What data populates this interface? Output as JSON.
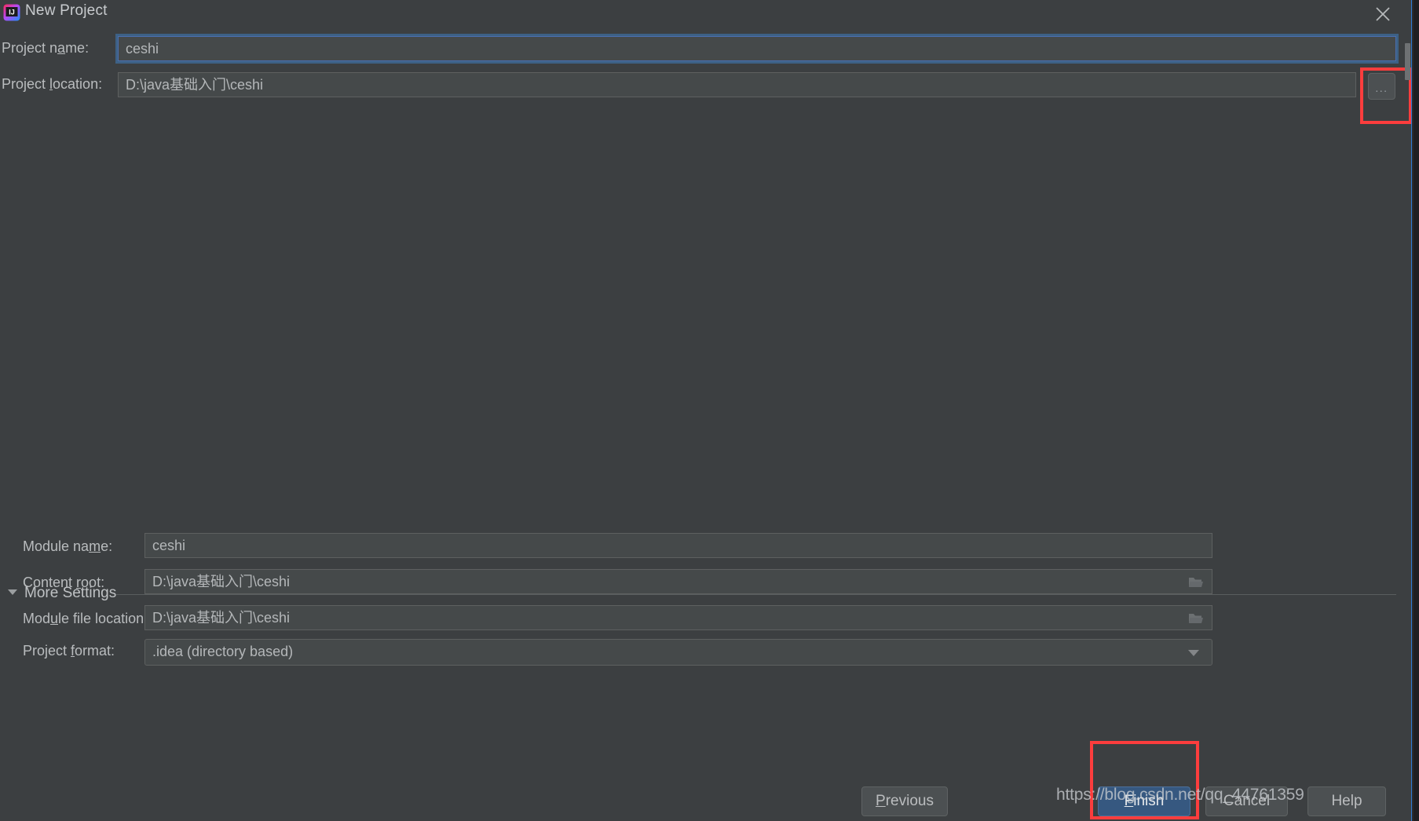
{
  "window": {
    "title": "New Project",
    "app_icon": "intellij-idea-icon",
    "close_icon": "close-icon",
    "accent_color": "#2d7cd6",
    "background_color": "#3c3f41"
  },
  "top_form": {
    "rows": [
      {
        "label_pre": "Project n",
        "label_mnemonic": "a",
        "label_post": "me:",
        "value": "ceshi",
        "focused": true,
        "icon": ""
      },
      {
        "label_pre": "Project ",
        "label_mnemonic": "l",
        "label_post": "ocation:",
        "value": "D:\\java基础入门\\ceshi",
        "focused": false,
        "icon": ""
      }
    ],
    "browse_button": {
      "label": "...",
      "icon": "ellipsis-icon"
    }
  },
  "more_settings": {
    "label": "More Settings",
    "expanded": true,
    "toggle_icon": "triangle-down-icon",
    "rows": [
      {
        "label_pre": "Module na",
        "label_mnemonic": "m",
        "label_post": "e:",
        "value": "ceshi",
        "icon": ""
      },
      {
        "label_pre": "Content ",
        "label_mnemonic": "r",
        "label_post": "oot:",
        "value": "D:\\java基础入门\\ceshi",
        "icon": "folder-icon"
      },
      {
        "label_pre": "Mod",
        "label_mnemonic": "u",
        "label_post": "le file location:",
        "value": "D:\\java基础入门\\ceshi",
        "icon": "folder-icon"
      },
      {
        "label_pre": "Project ",
        "label_mnemonic": "f",
        "label_post": "ormat:",
        "value": ".idea (directory based)",
        "icon": "chevron-down-icon"
      }
    ]
  },
  "buttons": {
    "previous": {
      "pre": "",
      "mnemonic": "P",
      "post": "revious"
    },
    "finish": {
      "pre": "",
      "mnemonic": "F",
      "post": "inish",
      "primary": true
    },
    "cancel": {
      "pre": "Cancel",
      "mnemonic": "",
      "post": ""
    },
    "help": {
      "pre": "Help",
      "mnemonic": "",
      "post": ""
    }
  },
  "watermark": {
    "text": "https://blog.csdn.net/qq_44761359"
  },
  "annotations": {
    "color": "#fc3d3d",
    "boxes": [
      "browse-button-highlight",
      "finish-button-highlight"
    ]
  }
}
